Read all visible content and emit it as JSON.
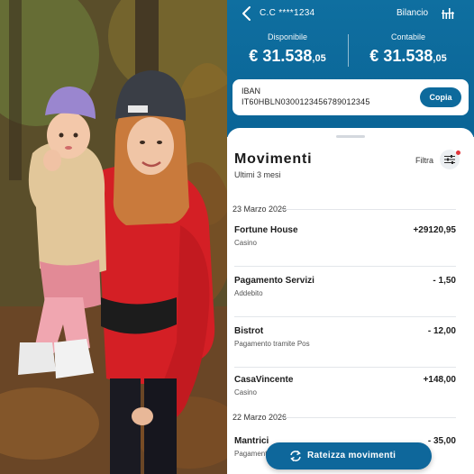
{
  "header": {
    "account_label": "C.C ****1234",
    "bilancio_label": "Bilancio",
    "icons": {
      "back": "chevron-left-icon",
      "chart": "bar-chart-icon"
    }
  },
  "balances": {
    "disponibile": {
      "label": "Disponibile",
      "currency": "€",
      "int": "31.538",
      "dec": ",05"
    },
    "contabile": {
      "label": "Contabile",
      "currency": "€",
      "int": "31.538",
      "dec": ",05"
    }
  },
  "iban": {
    "title": "IBAN",
    "value": "IT60HBLN0300123456789012345",
    "copy_label": "Copia"
  },
  "movements": {
    "title": "Movimenti",
    "subtitle": "Ultimi 3 mesi",
    "filter_label": "Filtra",
    "groups": [
      {
        "date": "23 Marzo 2026",
        "items": [
          {
            "name": "Fortune House",
            "sub": "Casino",
            "amount": "+29120,95"
          },
          {
            "name": "Pagamento Servizi",
            "sub": "Addebito",
            "amount": "- 1,50"
          },
          {
            "name": "Bistrot",
            "sub": "Pagamento tramite Pos",
            "amount": "- 12,00"
          },
          {
            "name": "CasaVincente",
            "sub": "Casino",
            "amount": "+148,00"
          }
        ]
      },
      {
        "date": "22 Marzo 2026",
        "items": [
          {
            "name": "Mantrici",
            "sub": "Pagamento tramite Pos",
            "amount": "- 35,00"
          }
        ]
      }
    ]
  },
  "cta": {
    "label": "Rateizza movimenti",
    "icon": "repeat-arrows-icon"
  },
  "colors": {
    "brand": "#0a6496",
    "button": "#0e679b",
    "badge": "#e0343a"
  }
}
